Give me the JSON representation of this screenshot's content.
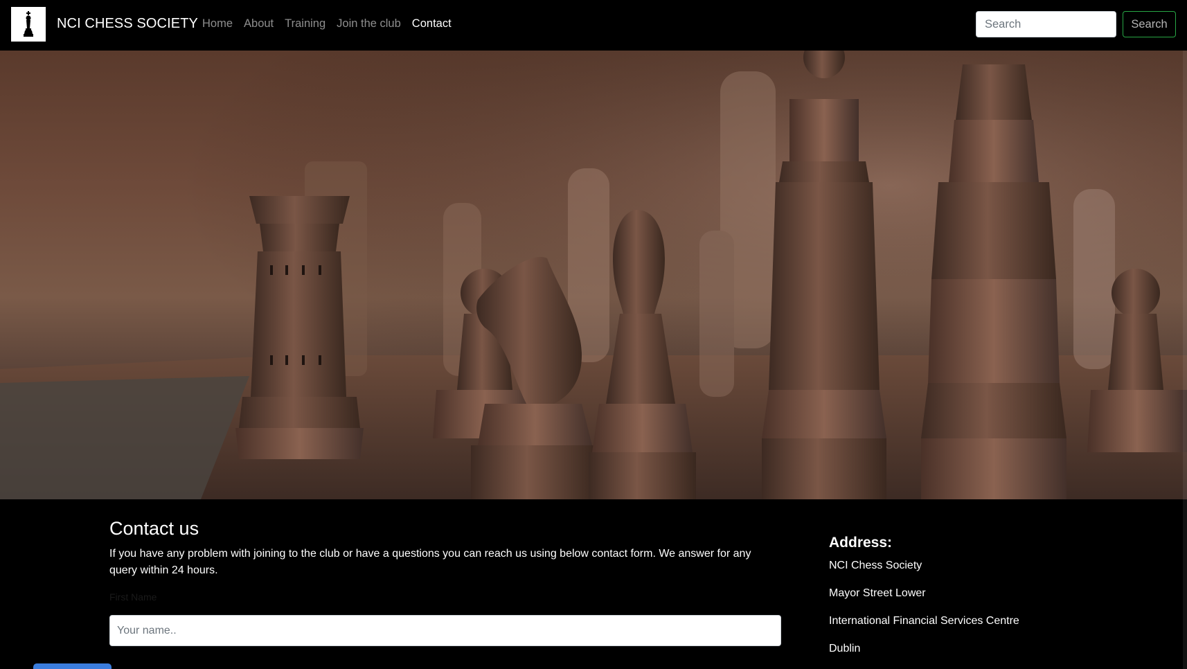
{
  "navbar": {
    "brand_name": "NCI CHESS SOCIETY",
    "links": [
      {
        "label": "Home",
        "active": false
      },
      {
        "label": "About",
        "active": false
      },
      {
        "label": "Training",
        "active": false
      },
      {
        "label": "Join the club",
        "active": false
      },
      {
        "label": "Contact",
        "active": true
      }
    ],
    "search": {
      "placeholder": "Search",
      "button_label": "Search"
    }
  },
  "contact": {
    "title": "Contact us",
    "description": "If you have any problem with joining to the club or have a questions you can reach us using below contact form. We answer for any query within 24 hours.",
    "name_label": "First Name",
    "name_placeholder": "Your name.."
  },
  "address": {
    "title": "Address:",
    "lines": [
      "NCI Chess Society",
      "Mayor Street Lower",
      "International Financial Services Centre",
      "Dublin"
    ]
  },
  "colors": {
    "background": "#000000",
    "search_border": "#28a745",
    "submit_button": "#3b7ddd"
  }
}
